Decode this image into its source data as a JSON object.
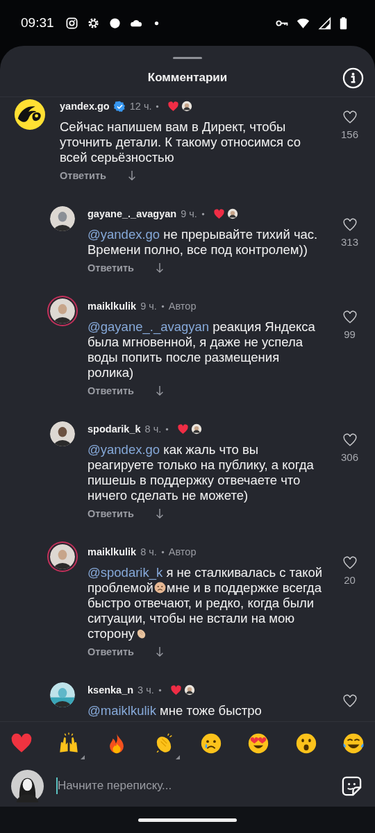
{
  "status_bar": {
    "time": "09:31"
  },
  "sheet": {
    "title": "Комментарии"
  },
  "comments": [
    {
      "username": "yandex.go",
      "verified": true,
      "time": "12 ч.",
      "author": false,
      "liked_by_author": true,
      "kind": "brand",
      "story_ring": false,
      "body": [
        {
          "kind": "text",
          "text": "Сейчас напишем вам в Директ, чтобы уточнить детали. К такому относимся со всей серьёзностью"
        }
      ],
      "reply_label": "Ответить",
      "likes": "156",
      "children": [
        {
          "username": "gayane_._avagyan",
          "verified": false,
          "time": "9 ч.",
          "author": false,
          "liked_by_author": true,
          "kind": "user",
          "story_ring": false,
          "body": [
            {
              "kind": "mention",
              "text": "@yandex.go"
            },
            {
              "kind": "text",
              "text": " не прерывайте тихий час. Времени полно, все под контролем))"
            }
          ],
          "reply_label": "Ответить",
          "likes": "313"
        },
        {
          "username": "maiklkulik",
          "verified": false,
          "time": "9 ч.",
          "author": true,
          "author_label": "Автор",
          "liked_by_author": false,
          "kind": "user",
          "story_ring": true,
          "body": [
            {
              "kind": "mention",
              "text": "@gayane_._avagyan"
            },
            {
              "kind": "text",
              "text": " реакция Яндекса была мгновенной, я даже не успела воды попить после размещения ролика)"
            }
          ],
          "reply_label": "Ответить",
          "likes": "99"
        },
        {
          "username": "spodarik_k",
          "verified": false,
          "time": "8 ч.",
          "author": false,
          "liked_by_author": true,
          "kind": "user",
          "story_ring": false,
          "body": [
            {
              "kind": "mention",
              "text": "@yandex.go"
            },
            {
              "kind": "text",
              "text": " как жаль что вы реагируете только на публику, а когда пишешь в поддержку отвечаете что ничего сделать не можете)"
            }
          ],
          "reply_label": "Ответить",
          "likes": "306"
        },
        {
          "username": "maiklkulik",
          "verified": false,
          "time": "8 ч.",
          "author": true,
          "author_label": "Автор",
          "liked_by_author": false,
          "kind": "user",
          "story_ring": true,
          "body": [
            {
              "kind": "mention",
              "text": "@spodarik_k"
            },
            {
              "kind": "text",
              "text": " я не сталкивалась с такой проблемой"
            },
            {
              "kind": "sad-emoji"
            },
            {
              "kind": "text",
              "text": "мне и в поддержке всегда быстро отвечают, и редко, когда были ситуации, чтобы не встали на мою сторону"
            },
            {
              "kind": "clap-emoji"
            }
          ],
          "reply_label": "Ответить",
          "likes": "20"
        },
        {
          "username": "ksenka_n",
          "verified": false,
          "time": "3 ч.",
          "author": false,
          "liked_by_author": true,
          "kind": "user",
          "story_ring": false,
          "body": [
            {
              "kind": "mention",
              "text": "@maiklkulik"
            },
            {
              "kind": "text",
              "text": " мне тоже быстро"
            }
          ]
        }
      ]
    }
  ],
  "emoji_bar": [
    {
      "kind": "heart",
      "variants": false
    },
    {
      "kind": "raised-hands",
      "variants": true
    },
    {
      "kind": "fire",
      "variants": false
    },
    {
      "kind": "clap",
      "variants": true
    },
    {
      "kind": "crying",
      "variants": false
    },
    {
      "kind": "heart-eyes",
      "variants": false
    },
    {
      "kind": "surprised",
      "variants": false
    },
    {
      "kind": "laughing",
      "variants": false
    }
  ],
  "composer": {
    "placeholder": "Начните переписку..."
  }
}
